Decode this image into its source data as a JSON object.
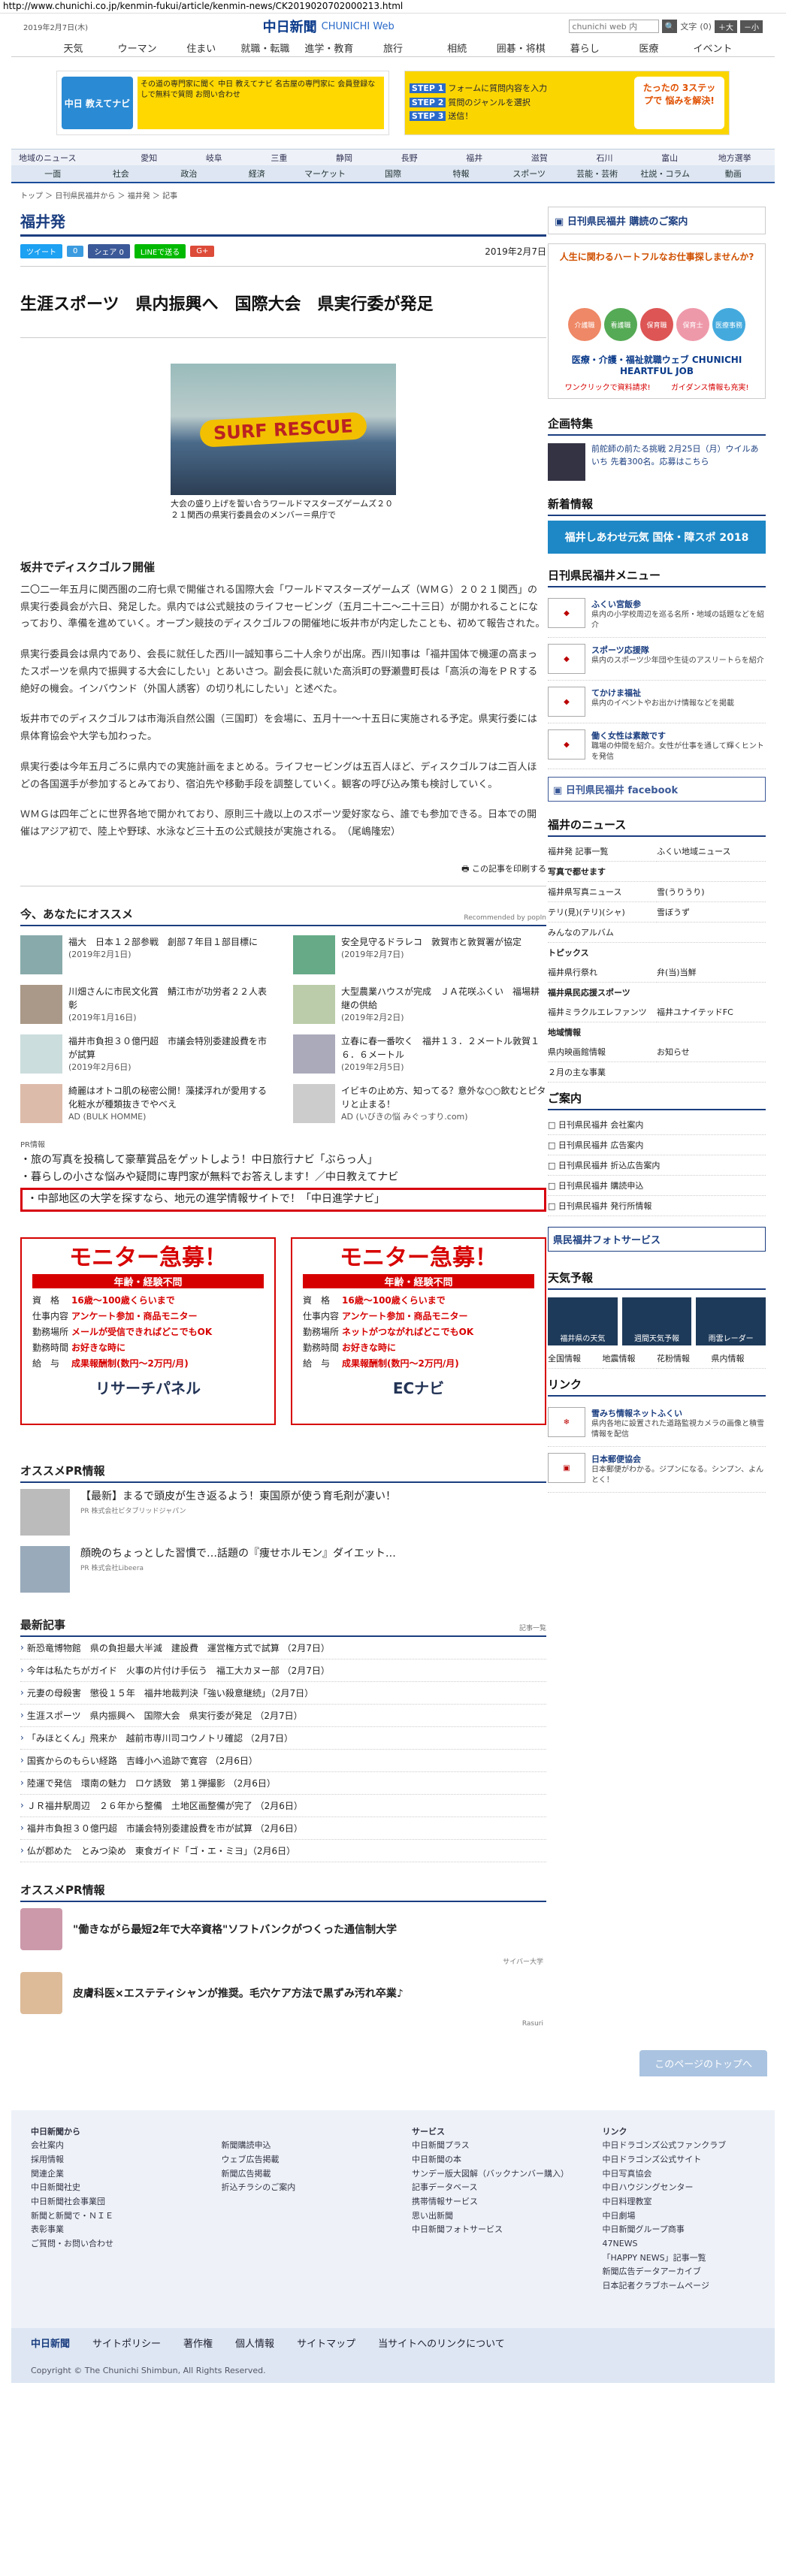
{
  "url": "http://www.chunichi.co.jp/kenmin-fukui/article/kenmin-news/CK2019020702000213.html",
  "header": {
    "date": "2019年2月7日(木)",
    "logo_jp": "中日新聞",
    "logo_en": "CHUNICHI Web",
    "search_placeholder": "chunichi web 内",
    "search_icon": "search-icon",
    "font_label": "文字",
    "font_reset": "(0)",
    "font_up": "＋大",
    "font_down": "－小"
  },
  "gnav": [
    "天気",
    "ウーマン",
    "住まい",
    "就職・転職",
    "進学・教育",
    "旅行",
    "相続",
    "囲碁・将棋",
    "暮らし",
    "医療",
    "イベント"
  ],
  "banners": {
    "b1_left": "中日 教えてナビ",
    "b1_text": "その道の専門家に聞く 中日 教えてナビ 名古屋の専門家に 会員登録なしで無料で質問 お問い合わせ",
    "b2_steps": [
      "フォームに質問内容を入力",
      "質問のジャンルを選択",
      "送信！"
    ],
    "b2_cta": "たったの 3ステップで 悩みを解決!"
  },
  "rnav1": {
    "label": "地域のニュース",
    "items": [
      "愛知",
      "岐阜",
      "三重",
      "静岡",
      "長野",
      "福井",
      "滋賀",
      "石川",
      "富山",
      "地方選挙"
    ]
  },
  "rnav2": [
    "一面",
    "社会",
    "政治",
    "経済",
    "マーケット",
    "国際",
    "特報",
    "スポーツ",
    "芸能・芸術",
    "社説・コラム",
    "動画"
  ],
  "breadcrumb": "トップ ＞ 日刊県民福井から ＞ 福井発 ＞ 記事",
  "article": {
    "pref": "福井発",
    "share": [
      "ツイート",
      "0",
      "シェア 0",
      "LINEで送る"
    ],
    "date": "2019年2月7日",
    "headline": "生涯スポーツ　県内振興へ　国際大会　県実行委が発足",
    "photo_banner": "SURF RESCUE",
    "photo_caption": "大会の盛り上げを誓い合うワールドマスターズゲームズ２０２１関西の県実行委員会のメンバー＝県庁で",
    "subhead": "坂井でディスクゴルフ開催",
    "paragraphs": [
      "二〇二一年五月に関西圏の二府七県で開催される国際大会「ワールドマスターズゲームズ（ＷＭＧ）２０２１関西」の県実行委員会が六日、発足した。県内では公式競技のライフセービング（五月二十二〜二十三日）が開かれることになっており、準備を進めていく。オープン競技のディスクゴルフの開催地に坂井市が内定したことも、初めて報告された。",
      "県実行委員会は県内であり、会長に就任した西川一誠知事ら二十人余りが出席。西川知事は「福井国体で機運の高まったスポーツを県内で振興する大会にしたい」とあいさつ。副会長に就いた高浜町の野瀬豊町長は「高浜の海をＰＲする絶好の機会。インバウンド（外国人誘客）の切り札にしたい」と述べた。",
      "坂井市でのディスクゴルフは市海浜自然公園（三国町）を会場に、五月十一〜十五日に実施される予定。県実行委には県体育協会や大学も加わった。",
      "県実行委は今年五月ごろに県内での実施計画をまとめる。ライフセービングは五百人ほど、ディスクゴルフは二百人ほどの各国選手が参加するとみており、宿泊先や移動手段を調整していく。観客の呼び込み策も検討していく。",
      "ＷＭＧは四年ごとに世界各地で開かれており、原則三十歳以上のスポーツ愛好家なら、誰でも参加できる。日本での開催はアジア初で、陸上や野球、水泳など三十五の公式競技が実施される。　（尾嶋隆宏）"
    ],
    "print_label": "この記事を印刷する"
  },
  "recommend": {
    "title": "今、あなたにオススメ",
    "powered": "Recommended by popIn",
    "items": [
      {
        "text": "福大　日本１２部参戦　創部７年目１部目標に",
        "date": "(2019年2月1日)"
      },
      {
        "text": "安全見守るドラレコ　敦賀市と敦賀署が協定",
        "date": "(2019年2月7日)"
      },
      {
        "text": "川畑さんに市民文化賞　鯖江市が功労者２２人表彰",
        "date": "(2019年1月16日)"
      },
      {
        "text": "大型農業ハウスが完成　ＪＡ花咲ふくい　福場耕継の供給",
        "date": "(2019年2月2日)"
      },
      {
        "text": "福井市負担３０億円超　市議会特別委建設費を市が試算",
        "date": "(2019年2月6日)"
      },
      {
        "text": "立春に春一番吹く　福井１３．２メートル敦賀１６．６メートル",
        "date": "(2019年2月5日)"
      },
      {
        "text": "綺麗はオトコ肌の秘密公開！藻揉浮れが愛用する化粧水が種類抜きでやべえ",
        "date": "AD (BULK HOMME)"
      },
      {
        "text": "イビキの止め方、知ってる？意外な○○飲むとピタリと止まる！",
        "date": "AD (いびきの悩 みぐっすり.com)"
      }
    ]
  },
  "pr_links": {
    "label": "PR情報",
    "items": [
      "旅の写真を投稿して豪華賞品をゲットしよう！中日旅行ナビ「ぶらっ人」",
      "暮らしの小さな悩みや疑問に専門家が無料でお答えします！／中日教えてナビ",
      "中部地区の大学を探すなら、地元の進学情報サイトで！「中日進学ナビ」"
    ]
  },
  "monitors": [
    {
      "title": "モニター急募！",
      "ribbon": "年齢・経験不問",
      "rows": [
        [
          "資　格",
          "16歳〜100歳くらいまで"
        ],
        [
          "仕事内容",
          "アンケート参加・商品モニター"
        ],
        [
          "勤務場所",
          "メールが受信できればどこでもOK"
        ],
        [
          "勤務時間",
          "お好きな時に"
        ],
        [
          "給　与",
          "成果報酬制(数円〜2万円/月)"
        ]
      ],
      "brand": "リサーチパネル"
    },
    {
      "title": "モニター急募！",
      "ribbon": "年齢・経験不問",
      "rows": [
        [
          "資　格",
          "16歳〜100歳くらいまで"
        ],
        [
          "仕事内容",
          "アンケート参加・商品モニター"
        ],
        [
          "勤務場所",
          "ネットがつながればどこでもOK"
        ],
        [
          "勤務時間",
          "お好きな時に"
        ],
        [
          "給　与",
          "成果報酬制(数円〜2万円/月)"
        ]
      ],
      "brand": "ECナビ"
    }
  ],
  "osusume_pr": {
    "title": "オススメPR情報",
    "items": [
      {
        "text": "【最新】まるで頭皮が生き返るよう！東国原が使う育毛剤が凄い！",
        "src": "PR 株式会社ビタブリッドジャパン"
      },
      {
        "text": "顔晩のちょっとした習慣で…話題の『痩せホルモン』ダイエット…",
        "src": "PR 株式会社Libeera"
      }
    ]
  },
  "latest": {
    "title": "最新記事",
    "more": "記事一覧",
    "items": [
      "新恐竜博物館　県の負担最大半減　建設費　運営権方式で試算 （2月7日）",
      "今年は私たちがガイド　火事の片付け手伝う　福工大カヌー部 （2月7日）",
      "元妻の母殺害　懲役１５年　福井地裁判決「強い殺意継続」（2月7日）",
      "生涯スポーツ　県内振興へ　国際大会　県実行委が発足 （2月7日）",
      "「みほとくん」飛来か　越前市専川司コウノトリ確認 （2月7日）",
      "国賓からのもらい経路　吉峰小へ追跡で寛容 （2月6日）",
      "陸運で発信　環南の魅力　ロケ誘致　第１弾撮影 （2月6日）",
      "ＪＲ福井駅周辺　２６年から整備　土地区画整備が完了 （2月6日）",
      "福井市負担３０億円超　市議会特別委建設費を市が試算 （2月6日）",
      "仏が郡めた　とみつ染め　東食ガイド「ゴ・エ・ミヨ」（2月6日）"
    ]
  },
  "pr2": {
    "title": "オススメPR情報",
    "items": [
      {
        "text": "\"働きながら最短2年で大卒資格\"ソフトバンクがつくった通信制大学",
        "src": "サイバー大学"
      },
      {
        "text": "皮膚科医×エステティシャンが推奨。毛穴ケア方法で黒ずみ汚れ卒業♪",
        "src": "Rasuri"
      }
    ]
  },
  "side": {
    "kenmin_label": "日刊県民福井 購読のご案内",
    "heartful_q": "人生に関わるハートフルなお仕事探しませんか?",
    "heartful_cats": [
      "介護職",
      "看護職",
      "保育職",
      "保育士",
      "医療事務"
    ],
    "heartful_title": "医療・介護・福祉就職ウェブ CHUNICHI HEARTFUL JOB",
    "heartful_links": [
      "ワンクリックで資料請求!",
      "ガイダンス情報も充実!"
    ],
    "kikaku_title": "企画特集",
    "kikaku_item": "前舵師の前たる挑戦 2月25日（月）ウイルあいち 先着300名。応募はこちら",
    "shinsei_title": "新着情報",
    "shinsei_banner": "福井しあわせ元気 国体・障スポ 2018",
    "menu_title": "日刊県民福井メニュー",
    "menu": [
      {
        "t": "ふくい宮飯参",
        "s": "県内の小学校周辺を巡る名所・地域の話題などを紹介"
      },
      {
        "t": "スポーツ応援隊",
        "s": "県内のスポーツ少年団や生徒のアスリートらを紹介"
      },
      {
        "t": "てかけま福祉",
        "s": "県内のイベントやお出かけ情報などを掲載"
      },
      {
        "t": "働く女性は素敵です",
        "s": "職場の仲間を紹介。女性が仕事を通して輝くヒントを発信"
      }
    ],
    "facebook": "日刊県民福井 facebook",
    "fukui_news": "福井のニュース",
    "fukui_links": [
      "福井発 記事一覧",
      "ふくい地域ニュース"
    ],
    "photo_title": "写真で都せます",
    "photo_links": [
      "福井県写真ニュース",
      "雪(うりうり)",
      "テリ(見)(テリ)(シャ)",
      "雪ぼうず"
    ],
    "photo_single": "みんなのアルバム",
    "topics_title": "トピックス",
    "topics_links": [
      "福井県行祭れ",
      "弁(当)当鮮"
    ],
    "team_title": "福井県民応援スポーツ",
    "team_links": [
      "福井ミラクルエレファンツ",
      "福井ユナイテッドFC"
    ],
    "area_title": "地域情報",
    "area_links": [
      "県内映画館情報",
      "お知らせ"
    ],
    "area_single": "２月の主な事業",
    "guide_title": "ご案内",
    "guide_links": [
      "日刊県民福井 会社案内",
      "日刊県民福井 広告案内",
      "日刊県民福井 折込広告案内",
      "日刊県民福井 購読申込",
      "日刊県民福井 発行所情報"
    ],
    "photoservice": "県民福井フォトサービス",
    "weather_title": "天気予報",
    "weather_tiles": [
      "福井県の天気",
      "週間天気予報",
      "雨雲レーダー"
    ],
    "weather_links": [
      "全国情報",
      "地震情報",
      "花粉情報",
      "県内情報"
    ],
    "link_title": "リンク",
    "link_items": [
      {
        "t": "雪みち情報ネットふくい",
        "s": "県内各地に設置された道路監視カメラの画像と積雪情報を配信"
      },
      {
        "t": "日本郵便協会",
        "s": "日本郵便がわかる。ジプンになる。シンプン、よんとく！"
      }
    ]
  },
  "totop": "このページのトップへ",
  "footer": {
    "cols": [
      {
        "title": "中日新聞から",
        "items": [
          "会社案内",
          "採用情報",
          "関連企業",
          "中日新聞社史",
          "中日新聞社会事業団",
          "新聞と新聞で・ＮＩＥ",
          "表彰事業",
          "ご質問・お問い合わせ"
        ]
      },
      {
        "title": "",
        "items": [
          "新聞購読申込",
          "ウェブ広告掲載",
          "新聞広告掲載",
          "折込チラシのご案内"
        ]
      },
      {
        "title": "サービス",
        "items": [
          "中日新聞プラス",
          "中日新聞の本",
          "サンデー版大図解（バックナンバー購入）",
          "記事データベース",
          "携帯情報サービス",
          "思い出新聞",
          "中日新聞フォトサービス"
        ]
      },
      {
        "title": "リンク",
        "items": [
          "中日ドラゴンズ公式ファンクラブ",
          "中日ドラゴンズ公式サイト",
          "中日写真協会",
          "中日ハウジングセンター",
          "中日料理教室",
          "中日劇場",
          "中日新聞グループ商事",
          "47NEWS",
          "「HAPPY NEWS」記事一覧",
          "新聞広告データアーカイブ",
          "日本記者クラブホームページ"
        ]
      }
    ],
    "bar": [
      "中日新聞",
      "サイトポリシー",
      "著作権",
      "個人情報",
      "サイトマップ",
      "当サイトへのリンクについて"
    ],
    "copyright": "Copyright © The Chunichi Shimbun, All Rights Reserved."
  }
}
